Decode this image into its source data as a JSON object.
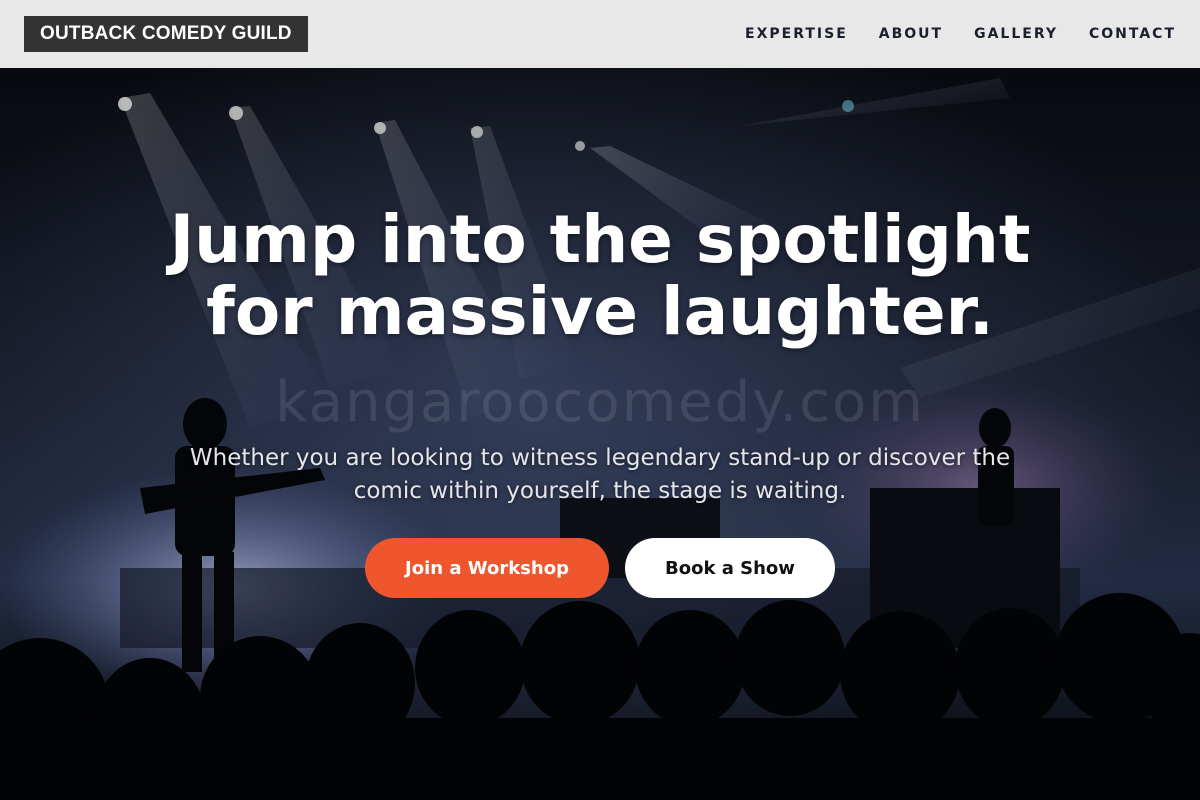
{
  "brand": {
    "name": "OUTBACK COMEDY GUILD"
  },
  "nav": {
    "items": [
      {
        "label": "EXPERTISE"
      },
      {
        "label": "ABOUT"
      },
      {
        "label": "GALLERY"
      },
      {
        "label": "CONTACT"
      }
    ]
  },
  "hero": {
    "headline": "Jump into the spotlight for massive laughter.",
    "subtitle": "Whether you are looking to witness legendary stand-up or discover the comic within yourself, the stage is waiting.",
    "watermark": "kangaroocomedy.com",
    "primary_cta": "Join a Workshop",
    "secondary_cta": "Book a Show"
  },
  "colors": {
    "header_bg": "#e8e8e8",
    "logo_bg": "#333333",
    "accent": "#f0562e",
    "nav_text": "#1a1f2b"
  },
  "icons": [
    "concert-stage-photo"
  ]
}
